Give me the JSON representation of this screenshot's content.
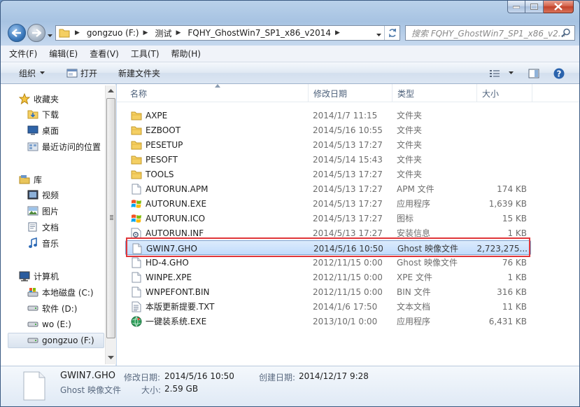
{
  "breadcrumbs": [
    "gongzuo (F:)",
    "测试",
    "FQHY_GhostWin7_SP1_x86_v2014"
  ],
  "search_placeholder": "搜索 FQHY_GhostWin7_SP1_x86_v2...",
  "menu": [
    "文件(F)",
    "编辑(E)",
    "查看(V)",
    "工具(T)",
    "帮助(H)"
  ],
  "toolbar": {
    "organize": "组织",
    "open": "打开",
    "new_folder": "新建文件夹"
  },
  "nav": {
    "favorites": "收藏夹",
    "fav_items": [
      "下载",
      "桌面",
      "最近访问的位置"
    ],
    "libraries": "库",
    "lib_items": [
      "视频",
      "图片",
      "文档",
      "音乐"
    ],
    "computer": "计算机",
    "drives": [
      "本地磁盘 (C:)",
      "软件 (D:)",
      "wo (E:)",
      "gongzuo (F:)"
    ]
  },
  "columns": {
    "name": "名称",
    "date": "修改日期",
    "type": "类型",
    "size": "大小"
  },
  "files": [
    {
      "name": "AXPE",
      "date": "2014/1/7 11:15",
      "type": "文件夹",
      "size": "",
      "icon": "folder"
    },
    {
      "name": "EZBOOT",
      "date": "2014/5/16 10:55",
      "type": "文件夹",
      "size": "",
      "icon": "folder"
    },
    {
      "name": "PESETUP",
      "date": "2014/5/13 17:27",
      "type": "文件夹",
      "size": "",
      "icon": "folder"
    },
    {
      "name": "PESOFT",
      "date": "2014/5/14 15:43",
      "type": "文件夹",
      "size": "",
      "icon": "folder"
    },
    {
      "name": "TOOLS",
      "date": "2014/5/13 17:27",
      "type": "文件夹",
      "size": "",
      "icon": "folder"
    },
    {
      "name": "AUTORUN.APM",
      "date": "2014/5/13 17:27",
      "type": "APM 文件",
      "size": "174 KB",
      "icon": "file"
    },
    {
      "name": "AUTORUN.EXE",
      "date": "2014/5/13 17:27",
      "type": "应用程序",
      "size": "1,639 KB",
      "icon": "windows"
    },
    {
      "name": "AUTORUN.ICO",
      "date": "2014/5/13 17:27",
      "type": "图标",
      "size": "15 KB",
      "icon": "windows"
    },
    {
      "name": "AUTORUN.INF",
      "date": "2014/5/13 17:27",
      "type": "安装信息",
      "size": "1 KB",
      "icon": "gear"
    },
    {
      "name": "GWIN7.GHO",
      "date": "2014/5/16 10:50",
      "type": "Ghost 映像文件",
      "size": "2,723,275...",
      "icon": "file",
      "selected": true
    },
    {
      "name": "HD-4.GHO",
      "date": "2012/11/15 0:00",
      "type": "Ghost 映像文件",
      "size": "76 KB",
      "icon": "file"
    },
    {
      "name": "WINPE.XPE",
      "date": "2012/11/15 0:00",
      "type": "XPE 文件",
      "size": "1 KB",
      "icon": "file"
    },
    {
      "name": "WNPEFONT.BIN",
      "date": "2012/11/15 0:00",
      "type": "BIN 文件",
      "size": "316 KB",
      "icon": "file"
    },
    {
      "name": "本版更新提要.TXT",
      "date": "2014/1/6 17:50",
      "type": "文本文档",
      "size": "11 KB",
      "icon": "text"
    },
    {
      "name": "一键装系统.EXE",
      "date": "2013/10/1 0:00",
      "type": "应用程序",
      "size": "6,431 KB",
      "icon": "globe"
    }
  ],
  "details": {
    "name": "GWIN7.GHO",
    "type": "Ghost 映像文件",
    "modified_label": "修改日期:",
    "modified": "2014/5/16 10:50",
    "created_label": "创建日期:",
    "created": "2014/12/17 9:28",
    "size_label": "大小:",
    "size": "2.59 GB"
  }
}
